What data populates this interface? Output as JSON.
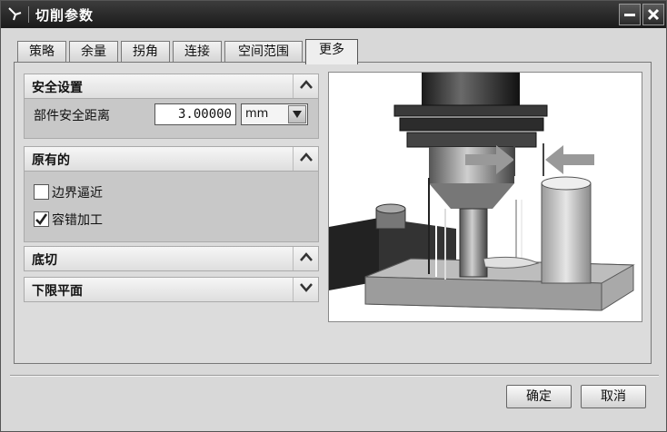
{
  "window": {
    "title": "切削参数"
  },
  "tabs": [
    {
      "label": "策略"
    },
    {
      "label": "余量"
    },
    {
      "label": "拐角"
    },
    {
      "label": "连接"
    },
    {
      "label": "空间范围"
    },
    {
      "label": "更多"
    }
  ],
  "active_tab": "更多",
  "sections": {
    "safety": {
      "title": "安全设置",
      "expanded": true,
      "part_clearance_label": "部件安全距离",
      "part_clearance_value": "3.00000",
      "unit": "mm"
    },
    "original": {
      "title": "原有的",
      "expanded": true,
      "boundary_approach_label": "边界逼近",
      "boundary_approach_checked": false,
      "tolerant_machining_label": "容错加工",
      "tolerant_machining_checked": true
    },
    "undercut": {
      "title": "底切",
      "expanded": false
    },
    "lower_limit": {
      "title": "下限平面",
      "expanded": false
    }
  },
  "icons": {
    "expanded_toggle": "chevron-up-icon",
    "collapsed_toggle": "chevron-down-icon",
    "dropdown": "triangle-down-icon",
    "check": "checkmark-icon"
  },
  "buttons": {
    "ok": "确定",
    "cancel": "取消"
  },
  "colors": {
    "titlebar": "#2a2a2a",
    "panel": "#dcdcdc",
    "section_body": "#c8c8c8"
  }
}
